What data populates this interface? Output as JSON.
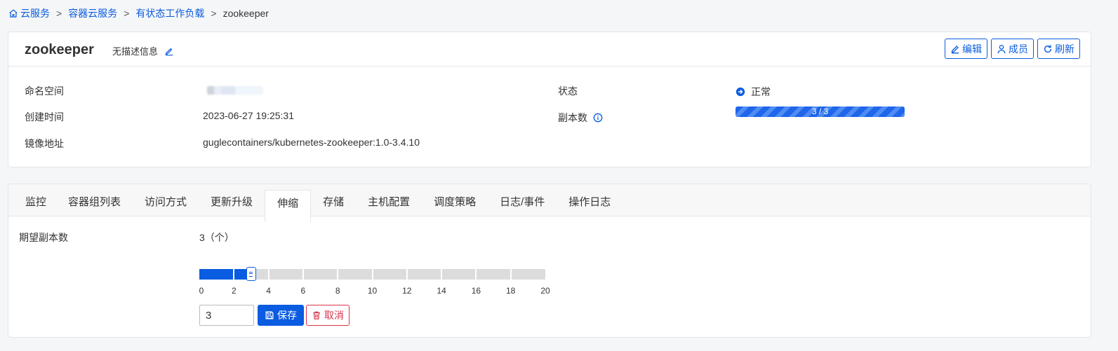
{
  "breadcrumb": {
    "items": [
      "云服务",
      "容器云服务",
      "有状态工作负载"
    ],
    "current": "zookeeper",
    "separator": ">"
  },
  "header": {
    "title": "zookeeper",
    "description": "无描述信息",
    "actions": {
      "edit": "编辑",
      "members": "成员",
      "refresh": "刷新"
    }
  },
  "info": {
    "namespace_label": "命名空间",
    "created_label": "创建时间",
    "created_value": "2023-06-27 19:25:31",
    "image_label": "镜像地址",
    "image_value": "guglecontainers/kubernetes-zookeeper:1.0-3.4.10",
    "status_label": "状态",
    "status_value": "正常",
    "replicas_label": "副本数",
    "replicas_value": "3 / 3",
    "replicas_ready": 3,
    "replicas_total": 3
  },
  "tabs": [
    "监控",
    "容器组列表",
    "访问方式",
    "更新升级",
    "伸缩",
    "存储",
    "主机配置",
    "调度策略",
    "日志/事件",
    "操作日志"
  ],
  "active_tab": "伸缩",
  "scale": {
    "label": "期望副本数",
    "value_text": "3（个）",
    "slider_min": 0,
    "slider_max": 20,
    "slider_value": 3,
    "tick_labels": [
      "0",
      "2",
      "4",
      "6",
      "8",
      "10",
      "12",
      "14",
      "16",
      "18",
      "20"
    ],
    "input_value": "3",
    "save_label": "保存",
    "cancel_label": "取消"
  },
  "colors": {
    "accent": "#0a5ce0",
    "danger": "#d8344a"
  },
  "icons": [
    "home-icon",
    "pencil-icon",
    "user-icon",
    "refresh-icon",
    "arrow-circle-icon",
    "info-icon",
    "save-icon",
    "trash-icon"
  ]
}
